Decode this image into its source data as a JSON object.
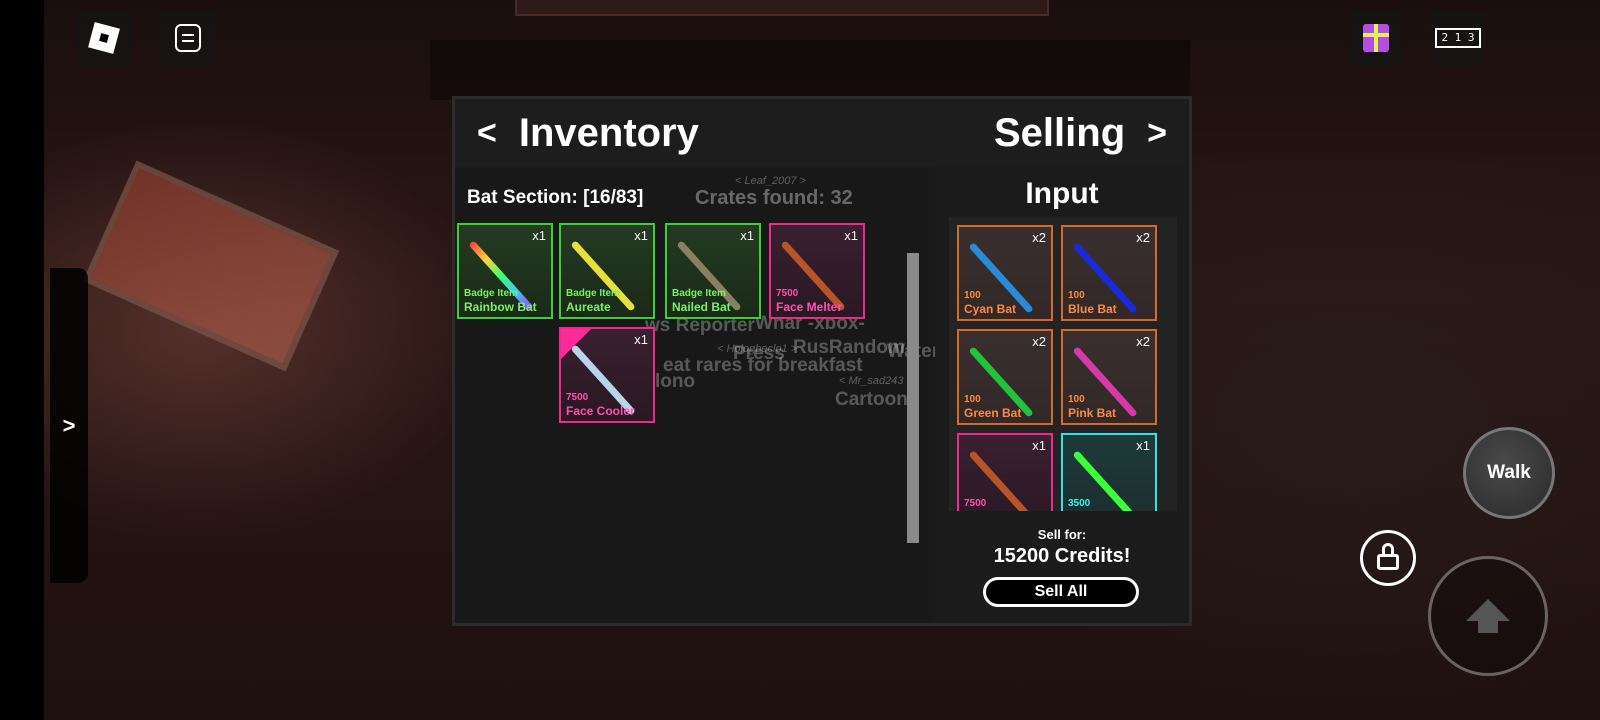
{
  "inventory": {
    "title": "Inventory",
    "prev_arrow": "<",
    "section_title": "Bat Section: [16/83]",
    "items": [
      {
        "name": "Rainbow Bat",
        "sub": "Badge Item",
        "qty": "x1",
        "rarity": "green",
        "bat_color": "linear-gradient(90deg,#ff3c3c,#ffd23c,#3cff6a,#3cc8ff,#a53cff)"
      },
      {
        "name": "Aureate",
        "sub": "Badge Item",
        "qty": "x1",
        "rarity": "green",
        "bat_color": "#e6e13a"
      },
      {
        "name": "Nailed Bat",
        "sub": "Badge Item",
        "qty": "x1",
        "rarity": "green",
        "bat_color": "#8a8060"
      },
      {
        "name": "Face Melter",
        "sub": "7500",
        "qty": "x1",
        "rarity": "pink",
        "bat_color": "#b8542a"
      },
      {
        "name": "Face Cooler",
        "sub": "7500",
        "qty": "x1",
        "rarity": "pink",
        "bat_color": "#b9d4e8"
      }
    ]
  },
  "overlay_text": {
    "crates_found": "Crates found: 32",
    "leaf": "< Leaf_2007 >",
    "reporter": "ws Reporter",
    "xbox": "Whar -xbox-",
    "rusrandom": "RusRandom",
    "press": "Press",
    "water": "Water",
    "rares": "eat rares for breakfast",
    "mono": "lono",
    "mr_sad": "< Mr_sad243 >",
    "cartoon": "Cartoon",
    "hologbeclo": "< Hologbeclo1 >"
  },
  "selling": {
    "title": "Selling",
    "next_arrow": ">",
    "input_title": "Input",
    "items": [
      {
        "name": "Cyan Bat",
        "sub": "100",
        "qty": "x2",
        "rarity": "orange",
        "bat_color": "#2a8ad6"
      },
      {
        "name": "Blue Bat",
        "sub": "100",
        "qty": "x2",
        "rarity": "orange",
        "bat_color": "#1a2ad6"
      },
      {
        "name": "Green Bat",
        "sub": "100",
        "qty": "x2",
        "rarity": "orange",
        "bat_color": "#22c33a"
      },
      {
        "name": "Pink Bat",
        "sub": "100",
        "qty": "x2",
        "rarity": "orange",
        "bat_color": "#d43aa8"
      },
      {
        "name": "",
        "sub": "7500",
        "qty": "x1",
        "rarity": "pink",
        "bat_color": "#b8542a"
      },
      {
        "name": "",
        "sub": "3500",
        "qty": "x1",
        "rarity": "cyan",
        "bat_color": "#3cff3c"
      }
    ],
    "sell_label": "Sell for:",
    "sell_value": "15200 Credits!",
    "sell_all": "Sell All"
  },
  "side_tab": {
    "label": ">"
  },
  "controls": {
    "walk": "Walk"
  },
  "topbar": {
    "podium_text": "2 1 3"
  }
}
